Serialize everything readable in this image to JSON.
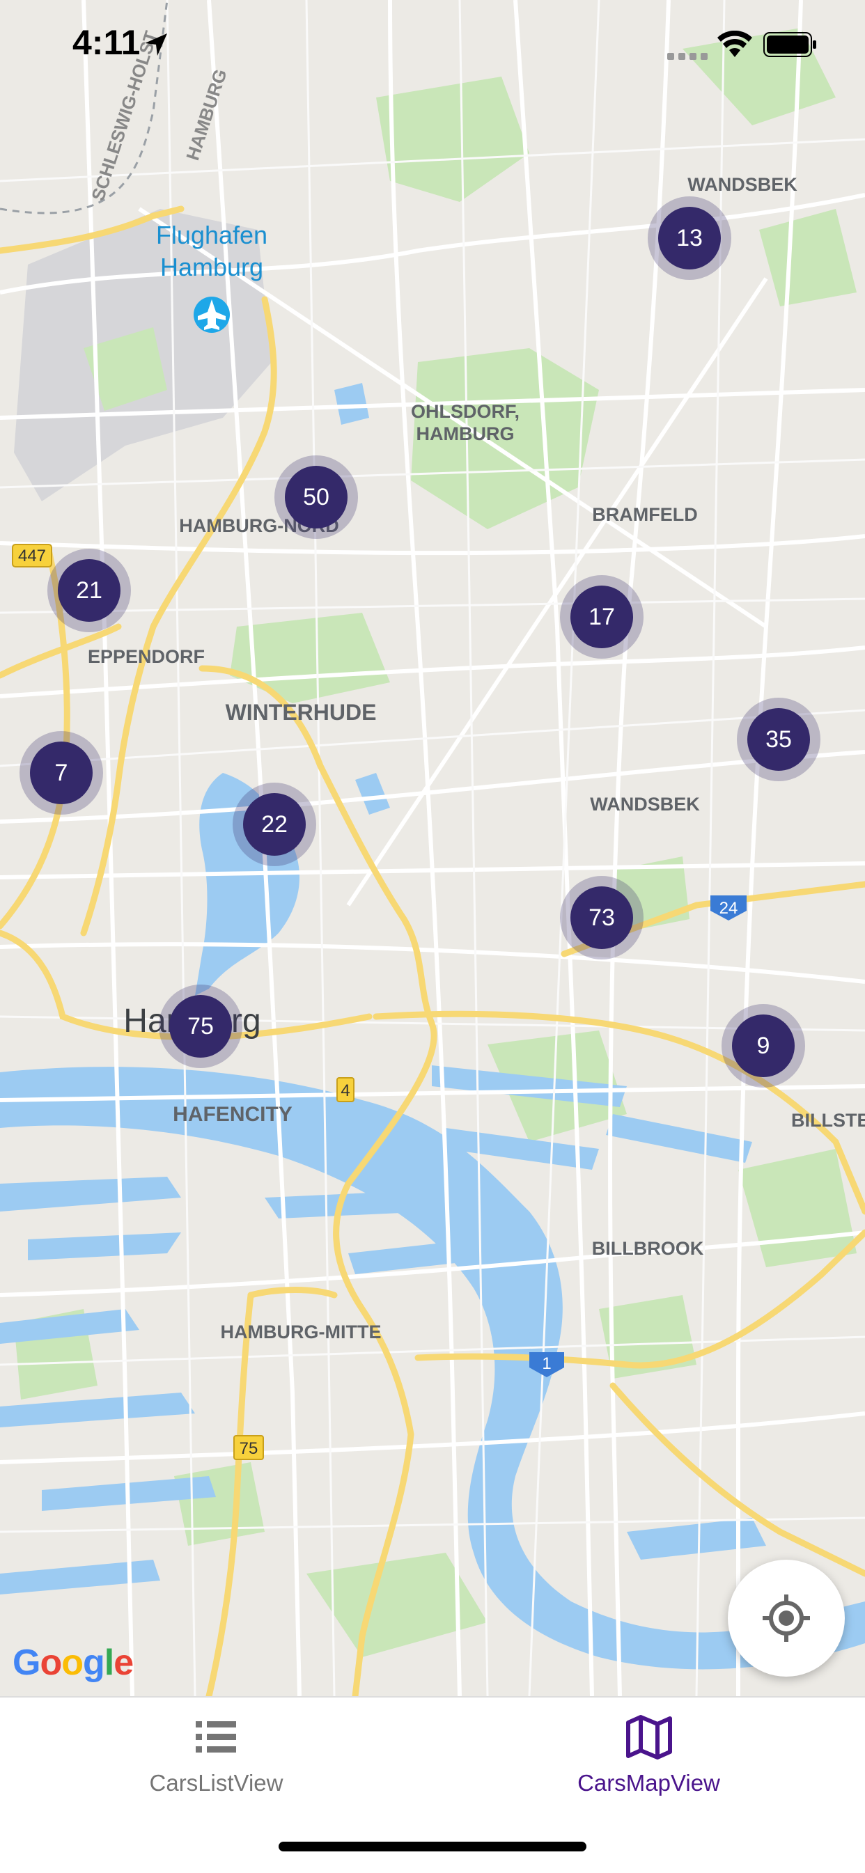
{
  "status_bar": {
    "time": "4:11"
  },
  "map": {
    "labels": {
      "schleswig_holstein": "SCHLESWIG-HOLST",
      "hamburg_border": "HAMBURG",
      "airport_line1": "Flughafen",
      "airport_line2": "Hamburg",
      "wandsbek_top": "WANDSBEK",
      "ohlsdorf_line1": "OHLSDORF,",
      "ohlsdorf_line2": "HAMBURG",
      "bramfeld": "BRAMFELD",
      "hamburg_nord": "HAMBURG-NORD",
      "eppendorf": "EPPENDORF",
      "winterhude": "WINTERHUDE",
      "wandsbek": "WANDSBEK",
      "hamburg_city": "Hamburg",
      "hafencity": "HAFENCITY",
      "billstedt": "BILLSTE",
      "billbrook": "BILLBROOK",
      "hamburg_mitte": "HAMBURG-MITTE"
    },
    "road_shields": {
      "r447": "447",
      "r24": "24",
      "r4": "4",
      "r1": "1",
      "r75": "75"
    },
    "clusters": [
      {
        "count": "13"
      },
      {
        "count": "50"
      },
      {
        "count": "21"
      },
      {
        "count": "17"
      },
      {
        "count": "35"
      },
      {
        "count": "7"
      },
      {
        "count": "22"
      },
      {
        "count": "73"
      },
      {
        "count": "75"
      },
      {
        "count": "9"
      }
    ],
    "attribution": "Google",
    "locate_icon": "my-location-icon"
  },
  "tabs": [
    {
      "label": "CarsListView",
      "icon": "list-icon",
      "color": "#757575",
      "active": false
    },
    {
      "label": "CarsMapView",
      "icon": "map-icon",
      "color": "#4a148c",
      "active": true
    }
  ],
  "colors": {
    "cluster": "#34296a",
    "active_tab": "#4a148c",
    "inactive_tab": "#757575",
    "water": "#9ccbf2",
    "park": "#c9e6b8",
    "road_major": "#f7d874"
  }
}
